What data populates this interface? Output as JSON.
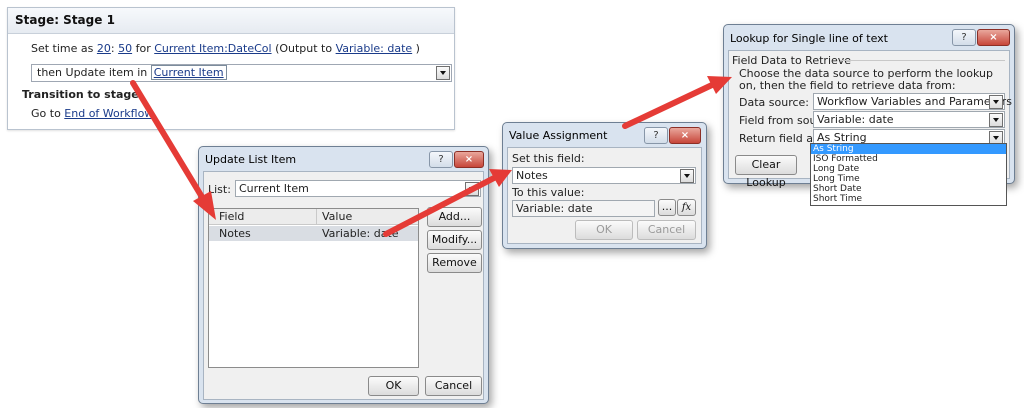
{
  "stage": {
    "title": "Stage: Stage 1",
    "set_time_prefix": "Set time as",
    "hour": "20",
    "colon": ":",
    "minute": "50",
    "for_word": "for",
    "date_col": "Current Item:DateCol",
    "output_prefix": "(Output to",
    "output_var": "Variable: date",
    "output_suffix": ")",
    "update_prefix": "then Update item in",
    "update_target": "Current Item",
    "transition_label": "Transition to stage",
    "goto_prefix": "Go to",
    "goto_target": "End of Workflow"
  },
  "update_dialog": {
    "title": "Update List Item",
    "help": "?",
    "close": "×",
    "list_label": "List:",
    "list_value": "Current Item",
    "col_field": "Field",
    "col_value": "Value",
    "rows": [
      {
        "field": "Notes",
        "value": "Variable: date"
      }
    ],
    "add_label": "Add...",
    "modify_label": "Modify...",
    "remove_label": "Remove",
    "ok_label": "OK",
    "cancel_label": "Cancel"
  },
  "value_dialog": {
    "title": "Value Assignment",
    "help": "?",
    "close": "×",
    "set_field_label": "Set this field:",
    "set_field_value": "Notes",
    "to_value_label": "To this value:",
    "to_value_value": "Variable: date",
    "ellipsis_label": "...",
    "fx_label": "fx",
    "ok_label": "OK",
    "cancel_label": "Cancel"
  },
  "lookup_dialog": {
    "title": "Lookup for Single line of text",
    "help": "?",
    "close": "×",
    "group_label": "Field Data to Retrieve",
    "description": "Choose the data source to perform the lookup on, then the field to retrieve data from:",
    "data_source_label": "Data source:",
    "data_source_value": "Workflow Variables and Parameters",
    "field_source_label": "Field from source:",
    "field_source_value": "Variable: date",
    "return_label": "Return field as:",
    "return_value": "As String",
    "clear_label": "Clear Lookup",
    "options": [
      "As String",
      "ISO Formatted",
      "Long Date",
      "Long Time",
      "Short Date",
      "Short Time"
    ],
    "selected_index": 0
  },
  "colors": {
    "arrow": "#e53b36",
    "dialog_frame": "#d9e3ef",
    "selection": "#3399ff"
  }
}
